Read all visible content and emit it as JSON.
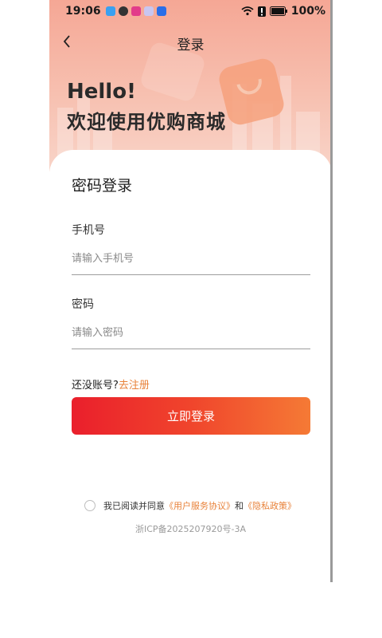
{
  "status_bar": {
    "time": "19:06",
    "battery": "100%"
  },
  "nav": {
    "title": "登录"
  },
  "hero": {
    "hello": "Hello!",
    "welcome": "欢迎使用优购商城"
  },
  "form": {
    "title": "密码登录",
    "phone_label": "手机号",
    "phone_placeholder": "请输入手机号",
    "phone_value": "",
    "password_label": "密码",
    "password_placeholder": "请输入密码",
    "password_value": "",
    "no_account_text": "还没账号?",
    "register_link": "去注册",
    "login_button": "立即登录"
  },
  "agreement": {
    "prefix": "我已阅读并同意",
    "user_agreement": "《用户服务协议》",
    "and": "和",
    "privacy_policy": "《隐私政策》"
  },
  "footer": {
    "icp": "浙ICP备2025207920号-3A"
  },
  "colors": {
    "accent_orange": "#e8823a",
    "button_start": "#ea1f2c",
    "button_end": "#f57a35"
  }
}
